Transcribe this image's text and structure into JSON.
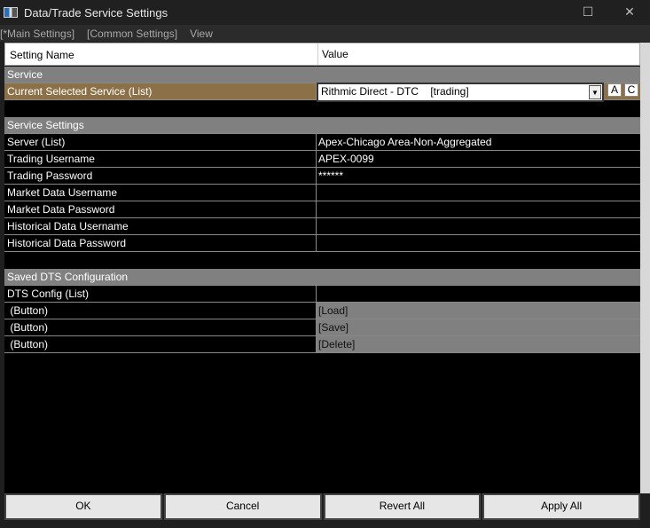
{
  "window": {
    "title": "Data/Trade Service Settings",
    "minimize": "☐",
    "close": "✕"
  },
  "menu": [
    "[*Main Settings]",
    "[Common Settings]",
    "View"
  ],
  "header": {
    "name": "Setting Name",
    "value": "Value"
  },
  "service": {
    "section": "Service",
    "row": "Current Selected Service (List)",
    "value": "Rithmic Direct - DTC    [trading]",
    "btn_a": "A",
    "btn_c": "C"
  },
  "service_settings": {
    "section": "Service Settings",
    "rows": [
      {
        "name": "Server (List)",
        "value": "Apex-Chicago Area-Non-Aggregated"
      },
      {
        "name": "Trading Username",
        "value": "APEX-0099"
      },
      {
        "name": "Trading Password",
        "value": "******"
      },
      {
        "name": "Market Data Username",
        "value": ""
      },
      {
        "name": "Market Data Password",
        "value": ""
      },
      {
        "name": "Historical Data Username",
        "value": ""
      },
      {
        "name": "Historical Data Password",
        "value": ""
      }
    ]
  },
  "dts": {
    "section": "Saved DTS Configuration",
    "config": "DTS Config (List)",
    "buttons": [
      {
        "name": " (Button)",
        "value": "[Load]"
      },
      {
        "name": " (Button)",
        "value": "[Save]"
      },
      {
        "name": " (Button)",
        "value": "[Delete]"
      }
    ]
  },
  "footer": {
    "ok": "OK",
    "cancel": "Cancel",
    "revert": "Revert All",
    "apply": "Apply All"
  }
}
